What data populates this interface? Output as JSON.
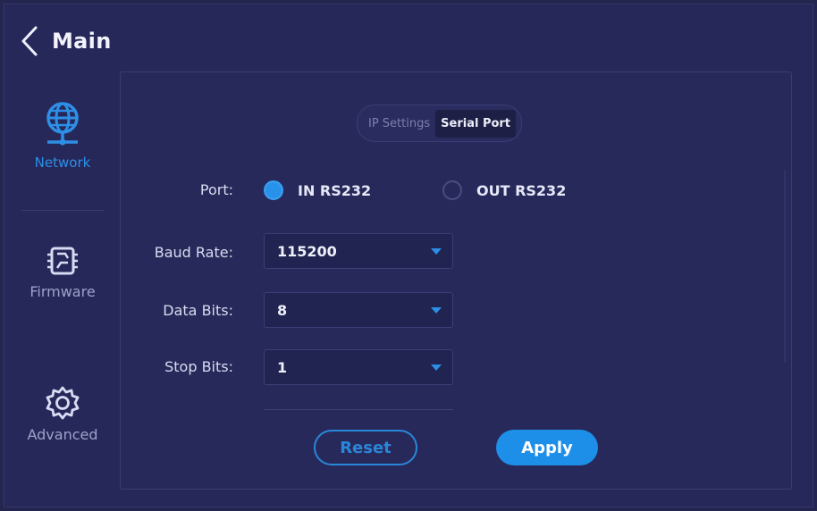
{
  "header": {
    "back_icon": "chevron-left-icon",
    "title": "Main"
  },
  "sidebar": {
    "items": [
      {
        "label": "Network",
        "icon": "globe-network-icon",
        "active": true
      },
      {
        "label": "Firmware",
        "icon": "circuit-board-icon",
        "active": false
      },
      {
        "label": "Advanced",
        "icon": "gear-icon",
        "active": false
      }
    ]
  },
  "tabs": [
    {
      "label": "IP Settings",
      "active": false
    },
    {
      "label": "Serial Port",
      "active": true
    }
  ],
  "form": {
    "port_label": "Port:",
    "port_options": [
      {
        "label": "IN RS232",
        "selected": true
      },
      {
        "label": "OUT RS232",
        "selected": false
      }
    ],
    "baud_label": "Baud Rate:",
    "baud_value": "115200",
    "data_bits_label": "Data Bits:",
    "data_bits_value": "8",
    "stop_bits_label": "Stop Bits:",
    "stop_bits_value": "1"
  },
  "buttons": {
    "reset": "Reset",
    "apply": "Apply"
  },
  "colors": {
    "background": "#24264f",
    "accent": "#1e8fe8",
    "active_nav": "#2d8fe6",
    "text": "#e8eaf6",
    "muted_text": "#9ea2c8"
  }
}
